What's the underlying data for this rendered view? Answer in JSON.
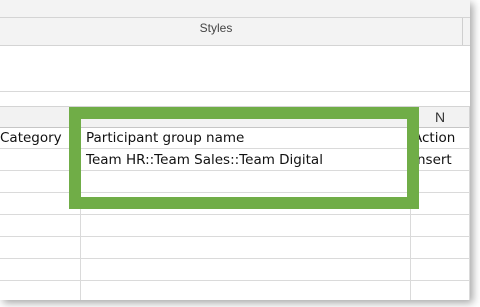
{
  "ribbon": {
    "group_label": "Styles"
  },
  "sheet": {
    "columns": [
      {
        "key": "prev",
        "header": ""
      },
      {
        "key": "M",
        "header": ""
      },
      {
        "key": "N",
        "header": "N"
      }
    ],
    "rows": [
      [
        "Category",
        "Participant group name",
        "Action"
      ],
      [
        "",
        "Team HR::Team Sales::Team Digital",
        "Insert"
      ],
      [
        "",
        "",
        ""
      ],
      [
        "",
        "",
        ""
      ],
      [
        "",
        "",
        ""
      ],
      [
        "",
        "",
        ""
      ],
      [
        "",
        "",
        ""
      ],
      [
        "",
        "",
        ""
      ]
    ]
  },
  "highlight": {
    "color": "#70ad47"
  }
}
